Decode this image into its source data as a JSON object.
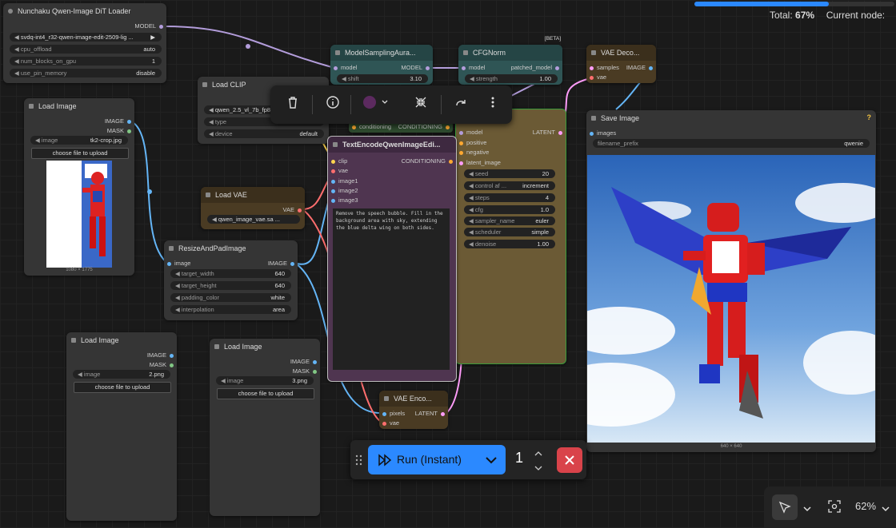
{
  "progress": {
    "label": "Total:",
    "value": "67%",
    "fraction": 0.67,
    "current_label": "Current node:"
  },
  "nodes": {
    "nunchaku": {
      "title": "Nunchaku Qwen-Image DiT Loader",
      "out": "MODEL",
      "widgets": [
        {
          "label": "",
          "value": "svdq-int4_r32-qwen-image-edit-2509-lig ..."
        },
        {
          "label": "cpu_offload",
          "value": "auto"
        },
        {
          "label": "num_blocks_on_gpu",
          "value": "1"
        },
        {
          "label": "use_pin_memory",
          "value": "disable"
        }
      ]
    },
    "load_clip": {
      "title": "Load CLIP",
      "widgets": [
        {
          "label": "",
          "value": "qwen_2.5_vl_7b_fp8 ..."
        },
        {
          "label": "type",
          "value": ""
        },
        {
          "label": "device",
          "value": "default"
        }
      ]
    },
    "load_image_1": {
      "title": "Load Image",
      "out1": "IMAGE",
      "out2": "MASK",
      "image_label": "image",
      "image_value": "tk2-crop.jpg",
      "upload": "choose file to upload",
      "dims": "1080 × 1775"
    },
    "load_vae": {
      "title": "Load VAE",
      "out": "VAE",
      "value": "qwen_image_vae.sa ..."
    },
    "resize": {
      "title": "ResizeAndPadImage",
      "in": "image",
      "out": "IMAGE",
      "widgets": [
        {
          "label": "target_width",
          "value": "640"
        },
        {
          "label": "target_height",
          "value": "640"
        },
        {
          "label": "padding_color",
          "value": "white"
        },
        {
          "label": "interpolation",
          "value": "area"
        }
      ]
    },
    "load_image_2": {
      "title": "Load Image",
      "out1": "IMAGE",
      "out2": "MASK",
      "image_label": "image",
      "image_value": "2.png",
      "upload": "choose file to upload"
    },
    "load_image_3": {
      "title": "Load Image",
      "out1": "IMAGE",
      "out2": "MASK",
      "image_label": "image",
      "image_value": "3.png",
      "upload": "choose file to upload"
    },
    "model_sampling": {
      "title": "ModelSamplingAura...",
      "in": "model",
      "out": "MODEL",
      "shift_label": "shift",
      "shift_value": "3.10"
    },
    "cfgnorm": {
      "title": "CFGNorm",
      "badge": "[BETA]",
      "in": "model",
      "out": "patched_model",
      "strength_label": "strength",
      "strength_value": "1.00"
    },
    "vae_decode": {
      "title": "VAE Deco...",
      "in1": "samples",
      "in2": "vae",
      "out": "IMAGE"
    },
    "cond_small": {
      "in": "conditioning",
      "out": "CONDITIONING"
    },
    "text_encode": {
      "title": "TextEncodeQwenImageEdi...",
      "out": "CONDITIONING",
      "inputs": [
        "clip",
        "vae",
        "image1",
        "image2",
        "image3"
      ],
      "prompt": "Remove the speech bubble. Fill in the background area with sky, extending the blue delta wing on both sides."
    },
    "ksampler": {
      "out": "LATENT",
      "inputs": [
        "model",
        "positive",
        "negative",
        "latent_image"
      ],
      "widgets": [
        {
          "label": "seed",
          "value": "20"
        },
        {
          "label": "control af ...",
          "value": "increment"
        },
        {
          "label": "steps",
          "value": "4"
        },
        {
          "label": "cfg",
          "value": "1.0"
        },
        {
          "label": "sampler_name",
          "value": "euler"
        },
        {
          "label": "scheduler",
          "value": "simple"
        },
        {
          "label": "denoise",
          "value": "1.00"
        }
      ]
    },
    "vae_encode": {
      "title": "VAE Enco...",
      "in1": "pixels",
      "in2": "vae",
      "out": "LATENT"
    },
    "save_image": {
      "title": "Save Image",
      "help": "?",
      "in": "images",
      "prefix_label": "filename_prefix",
      "prefix_value": "qwenie",
      "dims": "640 × 640"
    }
  },
  "run": {
    "label": "Run (Instant)",
    "count": "1"
  },
  "zoom": {
    "value": "62%"
  },
  "icons": {
    "delete": "trash-icon",
    "info": "info-icon",
    "color": "color-icon",
    "fit": "collapse-icon",
    "bypass": "redo-icon",
    "more": "more-vertical-icon"
  },
  "colors": {
    "model_wire": "#b39ddb",
    "image_wire": "#64b5f6",
    "clip_wire": "#ffd54f",
    "vae_wire": "#ff6e6e",
    "latent_wire": "#ff9cf9",
    "conditioning_wire": "#ffa931",
    "run_blue": "#2b89ff",
    "cancel_red": "#d9434a",
    "vae_node": "#4a3b23",
    "cond_node": "#2e6b3a"
  }
}
